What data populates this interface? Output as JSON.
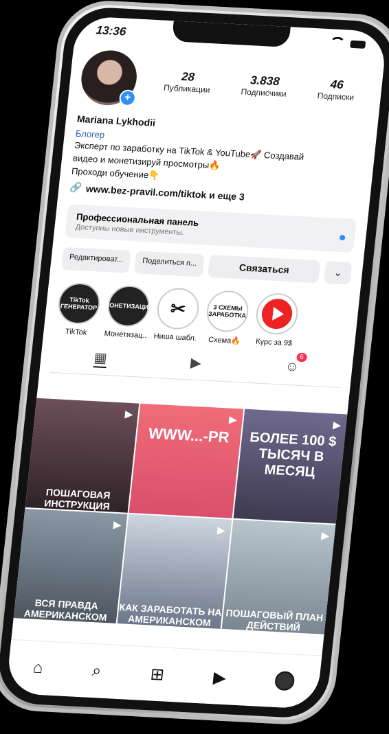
{
  "status": {
    "time": "13:36"
  },
  "profile": {
    "stats": [
      {
        "num": "28",
        "label": "Публикации"
      },
      {
        "num": "3.838",
        "label": "Подписчики"
      },
      {
        "num": "46",
        "label": "Подписки"
      }
    ],
    "name": "Mariana Lykhodii",
    "category": "Блогер",
    "bio": [
      "Эксперт по заработку на TikTok & YouTube🚀 Создавай",
      "видео и монетизируй просмотры🔥",
      "Проходи обучение👇"
    ],
    "link": "www.bez-pravil.com/tiktok и еще 3"
  },
  "panel": {
    "title": "Профессиональная панель",
    "subtitle": "Доступны новые инструменты."
  },
  "buttons": {
    "edit": "Редактироват...",
    "share": "Поделиться п...",
    "contact": "Связаться"
  },
  "highlights": [
    {
      "label": "TikTok",
      "inner": "TikTok ГЕНЕРАТОР"
    },
    {
      "label": "Монетизац...",
      "inner": "МОНЕТИЗАЦИЯ"
    },
    {
      "label": "Ниша шабл...",
      "inner": "✂"
    },
    {
      "label": "Схема🔥",
      "inner": "3 СХЕМЫ ЗАРАБОТКА"
    },
    {
      "label": "Курс за 9$",
      "inner": ""
    }
  ],
  "tabs": {
    "badge": "6"
  },
  "grid": {
    "texts": [
      "ПОШАГОВАЯ ИНСТРУКЦИЯ",
      "WWW...-PR",
      "БОЛЕЕ 100 $ ТЫСЯЧ В МЕСЯЦ",
      "ВСЯ ПРАВДА АМЕРИКАНСКОМ",
      "КАК ЗАРАБОТАТЬ НА АМЕРИКАНСКОМ",
      "ПОШАГОВЫЙ ПЛАН ДЕЙСТВИЙ"
    ]
  }
}
